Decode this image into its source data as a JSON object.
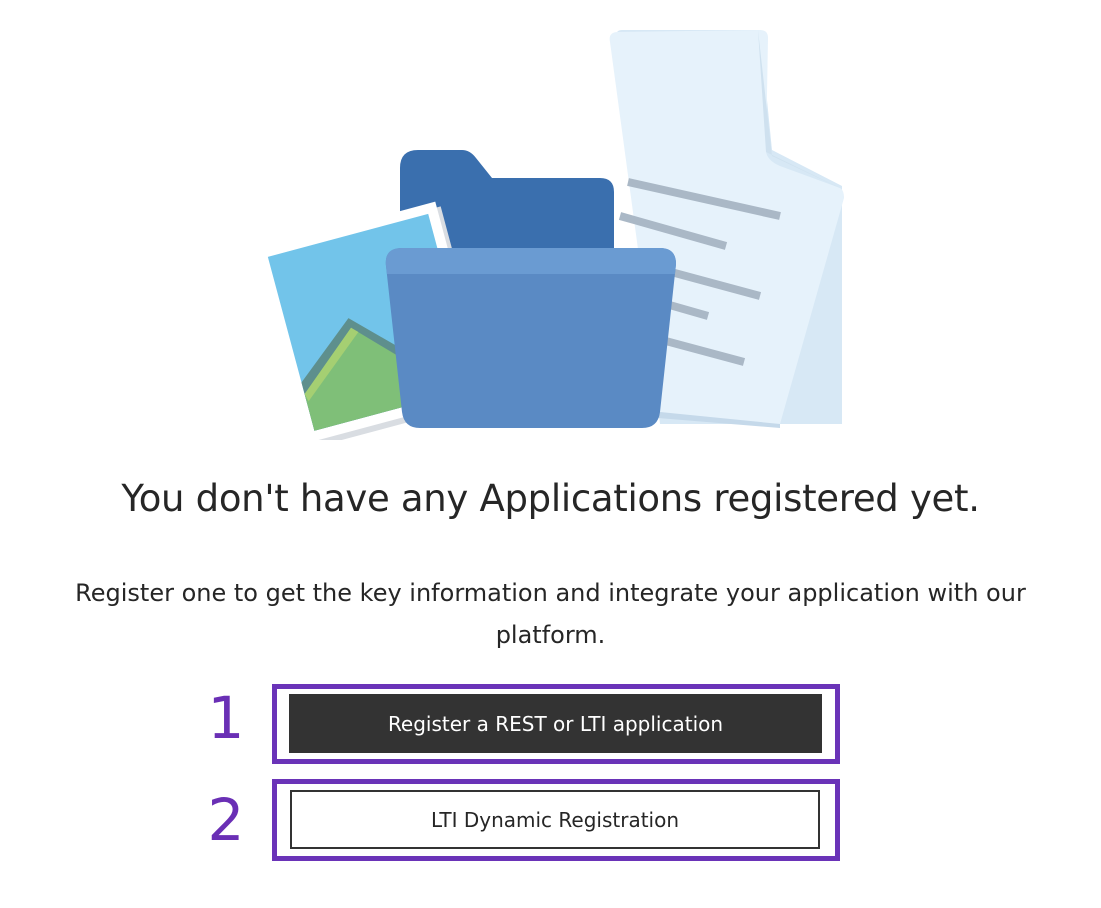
{
  "empty_state": {
    "illustration_icon": "folder-with-image-and-document-illustration",
    "title": "You don't have any Applications registered yet.",
    "description": "Register one to get the key information and integrate your application with our platform."
  },
  "actions": {
    "register_rest_lti_label": "Register a REST or LTI application",
    "lti_dynamic_registration_label": "LTI Dynamic Registration"
  },
  "annotations": {
    "step_1": "1",
    "step_2": "2",
    "highlight_color": "#6a33b8"
  },
  "colors": {
    "primary_button_bg": "#333333",
    "primary_button_text": "#ffffff",
    "secondary_button_bg": "#ffffff",
    "text": "#262626"
  }
}
